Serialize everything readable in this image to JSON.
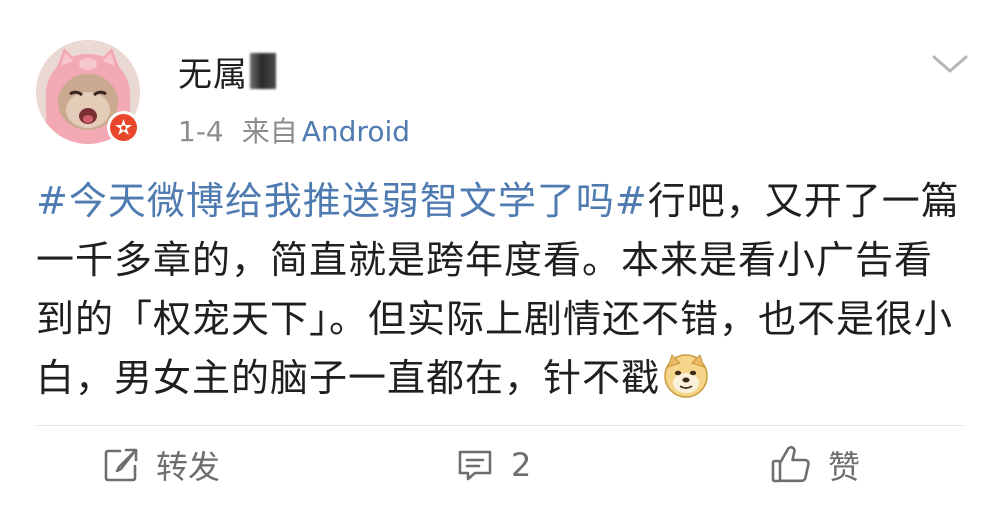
{
  "post": {
    "author": {
      "name": "无属"
    },
    "meta": {
      "date": "1-4",
      "source_prefix": "来自",
      "source_device": "Android"
    },
    "content": {
      "hashtag": "#今天微博给我推送弱智文学了吗#",
      "text": "行吧，又开了一篇一千多章的，简直就是跨年度看。本来是看小广告看到的「权宠天下」。但实际上剧情还不错，也不是很小白，男女主的脑子一直都在，针不戳",
      "emoji": "doge-emoji"
    },
    "actions": {
      "forward_label": "转发",
      "comment_count": "2",
      "like_label": "赞"
    },
    "icons": {
      "forward": "share-icon",
      "comment": "comment-icon",
      "like": "thumbs-up-icon",
      "menu": "chevron-down-icon"
    },
    "colors": {
      "link": "#4f7bb1",
      "badge": "#e8472b",
      "meta_text": "#8d8d8d"
    }
  }
}
